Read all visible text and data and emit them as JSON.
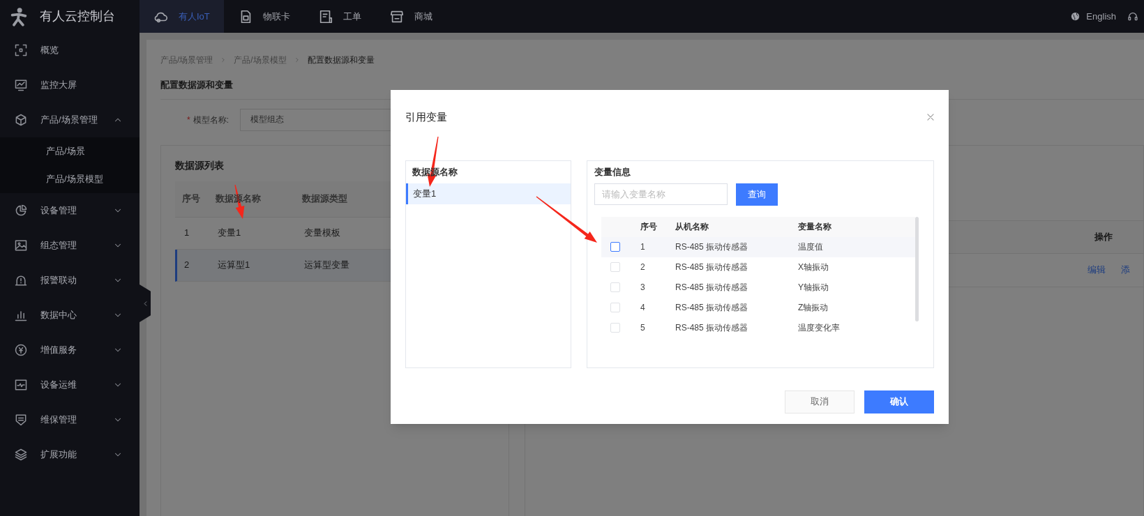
{
  "topbar": {
    "logo_text": "有人云控制台",
    "nav": [
      {
        "label": "有人IoT",
        "selected": true
      },
      {
        "label": "物联卡",
        "selected": false
      },
      {
        "label": "工单",
        "selected": false
      },
      {
        "label": "商城",
        "selected": false
      }
    ],
    "language": "English"
  },
  "sidebar": {
    "items": [
      {
        "label": "概览",
        "kind": "link"
      },
      {
        "label": "监控大屏",
        "kind": "link"
      },
      {
        "label": "产品/场景管理",
        "kind": "group",
        "expanded": true,
        "children": [
          {
            "label": "产品/场景"
          },
          {
            "label": "产品/场景模型"
          }
        ]
      },
      {
        "label": "设备管理",
        "kind": "group",
        "expanded": false
      },
      {
        "label": "组态管理",
        "kind": "group",
        "expanded": false
      },
      {
        "label": "报警联动",
        "kind": "group",
        "expanded": false
      },
      {
        "label": "数据中心",
        "kind": "group",
        "expanded": false
      },
      {
        "label": "增值服务",
        "kind": "group",
        "expanded": false
      },
      {
        "label": "设备运维",
        "kind": "group",
        "expanded": false
      },
      {
        "label": "维保管理",
        "kind": "group",
        "expanded": false
      },
      {
        "label": "扩展功能",
        "kind": "group",
        "expanded": false
      }
    ]
  },
  "page": {
    "breadcrumb": [
      "产品/场景管理",
      "产品/场景模型",
      "配置数据源和变量"
    ],
    "heading": "配置数据源和变量",
    "form": {
      "required_mark": "*",
      "label": "模型名称:",
      "value": "模型组态"
    },
    "source_list": {
      "title": "数据源列表",
      "columns": [
        "序号",
        "数据源名称",
        "数据源类型"
      ],
      "rows": [
        {
          "cells": [
            "1",
            "变量1",
            "变量模板"
          ],
          "selected": false
        },
        {
          "cells": [
            "2",
            "运算型1",
            "运算型变量"
          ],
          "selected": true
        }
      ]
    },
    "variable_table": {
      "column": "操作",
      "actions": [
        "编辑",
        "添"
      ]
    }
  },
  "dialog": {
    "title": "引用变量",
    "sources": {
      "header": "数据源名称",
      "items": [
        {
          "label": "变量1",
          "selected": true
        }
      ]
    },
    "variables": {
      "title": "变量信息",
      "search_placeholder": "请输入变量名称",
      "search_button": "查询",
      "columns": [
        "序号",
        "从机名称",
        "变量名称"
      ],
      "rows": [
        {
          "cells": [
            "1",
            "RS-485 振动传感器",
            "温度值"
          ],
          "checked": false,
          "highlighted": true
        },
        {
          "cells": [
            "2",
            "RS-485 振动传感器",
            "X轴振动"
          ],
          "checked": false,
          "highlighted": false
        },
        {
          "cells": [
            "3",
            "RS-485 振动传感器",
            "Y轴振动"
          ],
          "checked": false,
          "highlighted": false
        },
        {
          "cells": [
            "4",
            "RS-485 振动传感器",
            "Z轴振动"
          ],
          "checked": false,
          "highlighted": false
        },
        {
          "cells": [
            "5",
            "RS-485 振动传感器",
            "温度变化率"
          ],
          "checked": false,
          "highlighted": false
        }
      ]
    },
    "buttons": [
      {
        "label": "取消",
        "kind": "secondary"
      },
      {
        "label": "确认",
        "kind": "primary"
      }
    ]
  }
}
